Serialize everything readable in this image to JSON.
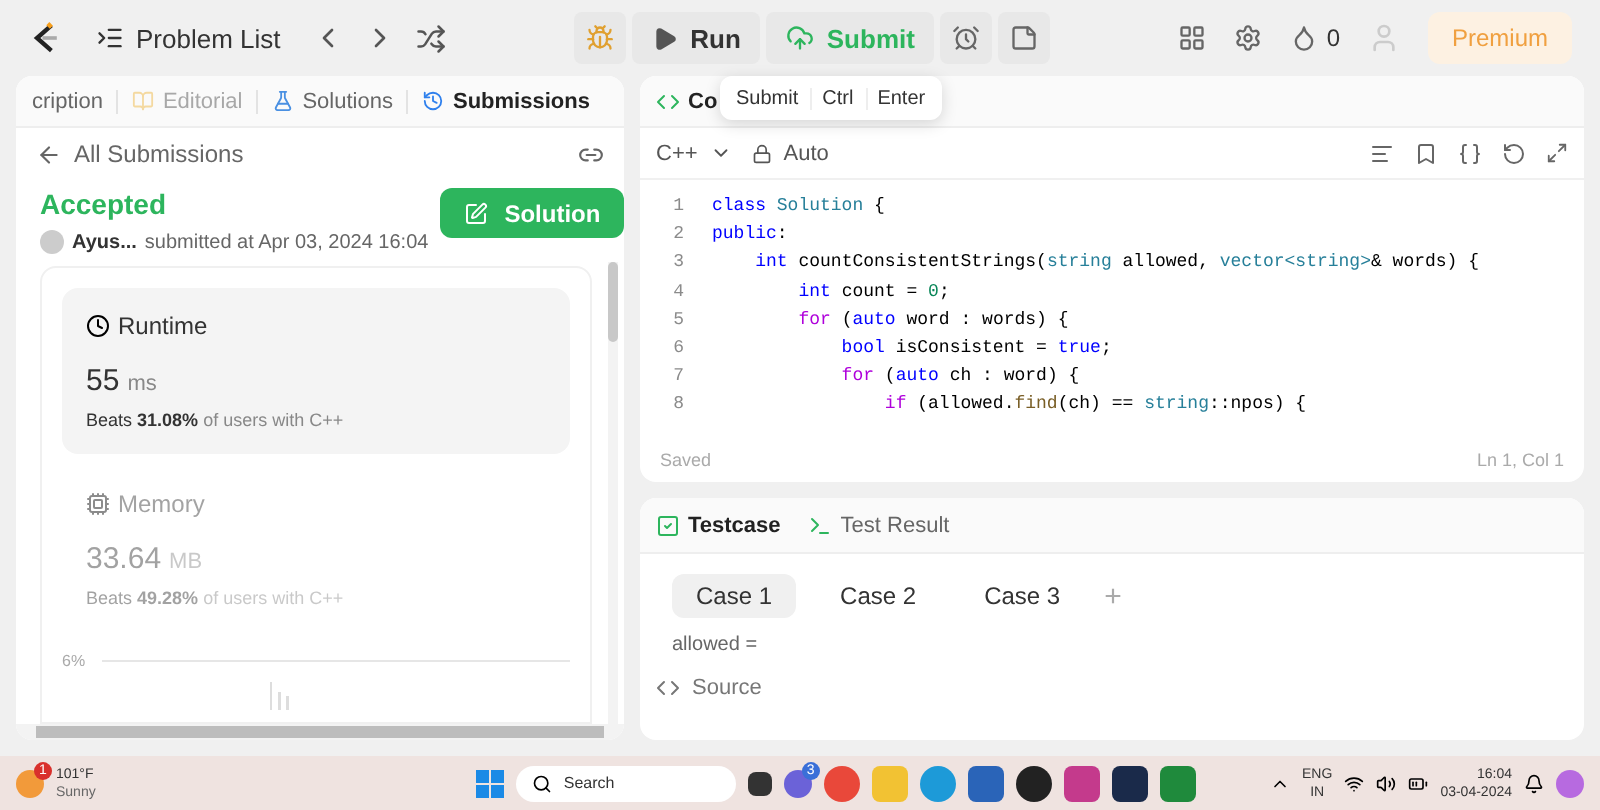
{
  "topbar": {
    "problem_list": "Problem List",
    "run": "Run",
    "submit": "Submit",
    "streak": "0",
    "premium": "Premium"
  },
  "tooltip": {
    "label": "Submit",
    "keys": [
      "Ctrl",
      "Enter"
    ]
  },
  "left_panel": {
    "tabs": [
      {
        "label": "cription",
        "selected": false,
        "disabled": false
      },
      {
        "label": "Editorial",
        "selected": false,
        "disabled": true
      },
      {
        "label": "Solutions",
        "selected": false,
        "disabled": false
      },
      {
        "label": "Submissions",
        "selected": true,
        "disabled": false
      }
    ],
    "back_label": "All Submissions",
    "status": "Accepted",
    "user": "Ayus...",
    "submitted": "submitted at Apr 03, 2024 16:04",
    "solution_button": "Solution",
    "cards": [
      {
        "kind": "runtime",
        "title": "Runtime",
        "value": "55",
        "unit": "ms",
        "beats_prefix": "Beats",
        "beats": "31.08%",
        "beats_suffix": "of users with C++",
        "selected": true
      },
      {
        "kind": "memory",
        "title": "Memory",
        "value": "33.64",
        "unit": "MB",
        "beats_prefix": "Beats",
        "beats": "49.28%",
        "beats_suffix": "of users with C++",
        "selected": false
      }
    ],
    "chart_label": "6%"
  },
  "code_panel": {
    "title": "Co",
    "language": "C++",
    "mode": "Auto",
    "lines": [
      {
        "number": "1",
        "tokens": [
          {
            "text": "class ",
            "kind": "keyword"
          },
          {
            "text": "Solution",
            "kind": "type"
          },
          {
            "text": " {",
            "kind": "plain"
          }
        ]
      },
      {
        "number": "2",
        "tokens": [
          {
            "text": "public",
            "kind": "keyword"
          },
          {
            "text": ":",
            "kind": "plain"
          }
        ]
      },
      {
        "number": "3",
        "tokens": [
          {
            "text": "    int ",
            "kind": "keyword"
          },
          {
            "text": "countConsistentStrings(",
            "kind": "plain"
          },
          {
            "text": "string ",
            "kind": "type"
          },
          {
            "text": "allowed, ",
            "kind": "plain"
          },
          {
            "text": "vector<string>",
            "kind": "type"
          },
          {
            "text": "& words) {",
            "kind": "plain"
          }
        ]
      },
      {
        "number": "4",
        "tokens": [
          {
            "text": "        int ",
            "kind": "keyword"
          },
          {
            "text": "count = ",
            "kind": "plain"
          },
          {
            "text": "0",
            "kind": "number"
          },
          {
            "text": ";",
            "kind": "plain"
          }
        ]
      },
      {
        "number": "5",
        "tokens": [
          {
            "text": "        for ",
            "kind": "control"
          },
          {
            "text": "(",
            "kind": "plain"
          },
          {
            "text": "auto ",
            "kind": "keyword"
          },
          {
            "text": "word : words) {",
            "kind": "plain"
          }
        ]
      },
      {
        "number": "6",
        "tokens": [
          {
            "text": "            bool ",
            "kind": "keyword"
          },
          {
            "text": "isConsistent = ",
            "kind": "plain"
          },
          {
            "text": "true",
            "kind": "keyword"
          },
          {
            "text": ";",
            "kind": "plain"
          }
        ]
      },
      {
        "number": "7",
        "tokens": [
          {
            "text": "            for ",
            "kind": "control"
          },
          {
            "text": "(",
            "kind": "plain"
          },
          {
            "text": "auto ",
            "kind": "keyword"
          },
          {
            "text": "ch : word) {",
            "kind": "plain"
          }
        ]
      },
      {
        "number": "8",
        "tokens": [
          {
            "text": "                if ",
            "kind": "control"
          },
          {
            "text": "(allowed.",
            "kind": "plain"
          },
          {
            "text": "find",
            "kind": "function"
          },
          {
            "text": "(ch) == ",
            "kind": "plain"
          },
          {
            "text": "string",
            "kind": "type"
          },
          {
            "text": "::npos) {",
            "kind": "plain"
          }
        ]
      }
    ],
    "saved": "Saved",
    "cursor": "Ln 1, Col 1"
  },
  "test_panel": {
    "tabs": [
      {
        "label": "Testcase",
        "selected": true
      },
      {
        "label": "Test Result",
        "selected": false
      }
    ],
    "cases": [
      {
        "label": "Case 1",
        "selected": true
      },
      {
        "label": "Case 2",
        "selected": false
      },
      {
        "label": "Case 3",
        "selected": false
      }
    ],
    "add": "+",
    "field_label": "allowed =",
    "source": "Source"
  },
  "taskbar": {
    "weather_badge": "1",
    "temperature": "101°F",
    "condition": "Sunny",
    "search": "Search",
    "teams_badge": "3",
    "language": "ENG",
    "region": "IN",
    "time": "16:04",
    "date": "03-04-2024"
  }
}
